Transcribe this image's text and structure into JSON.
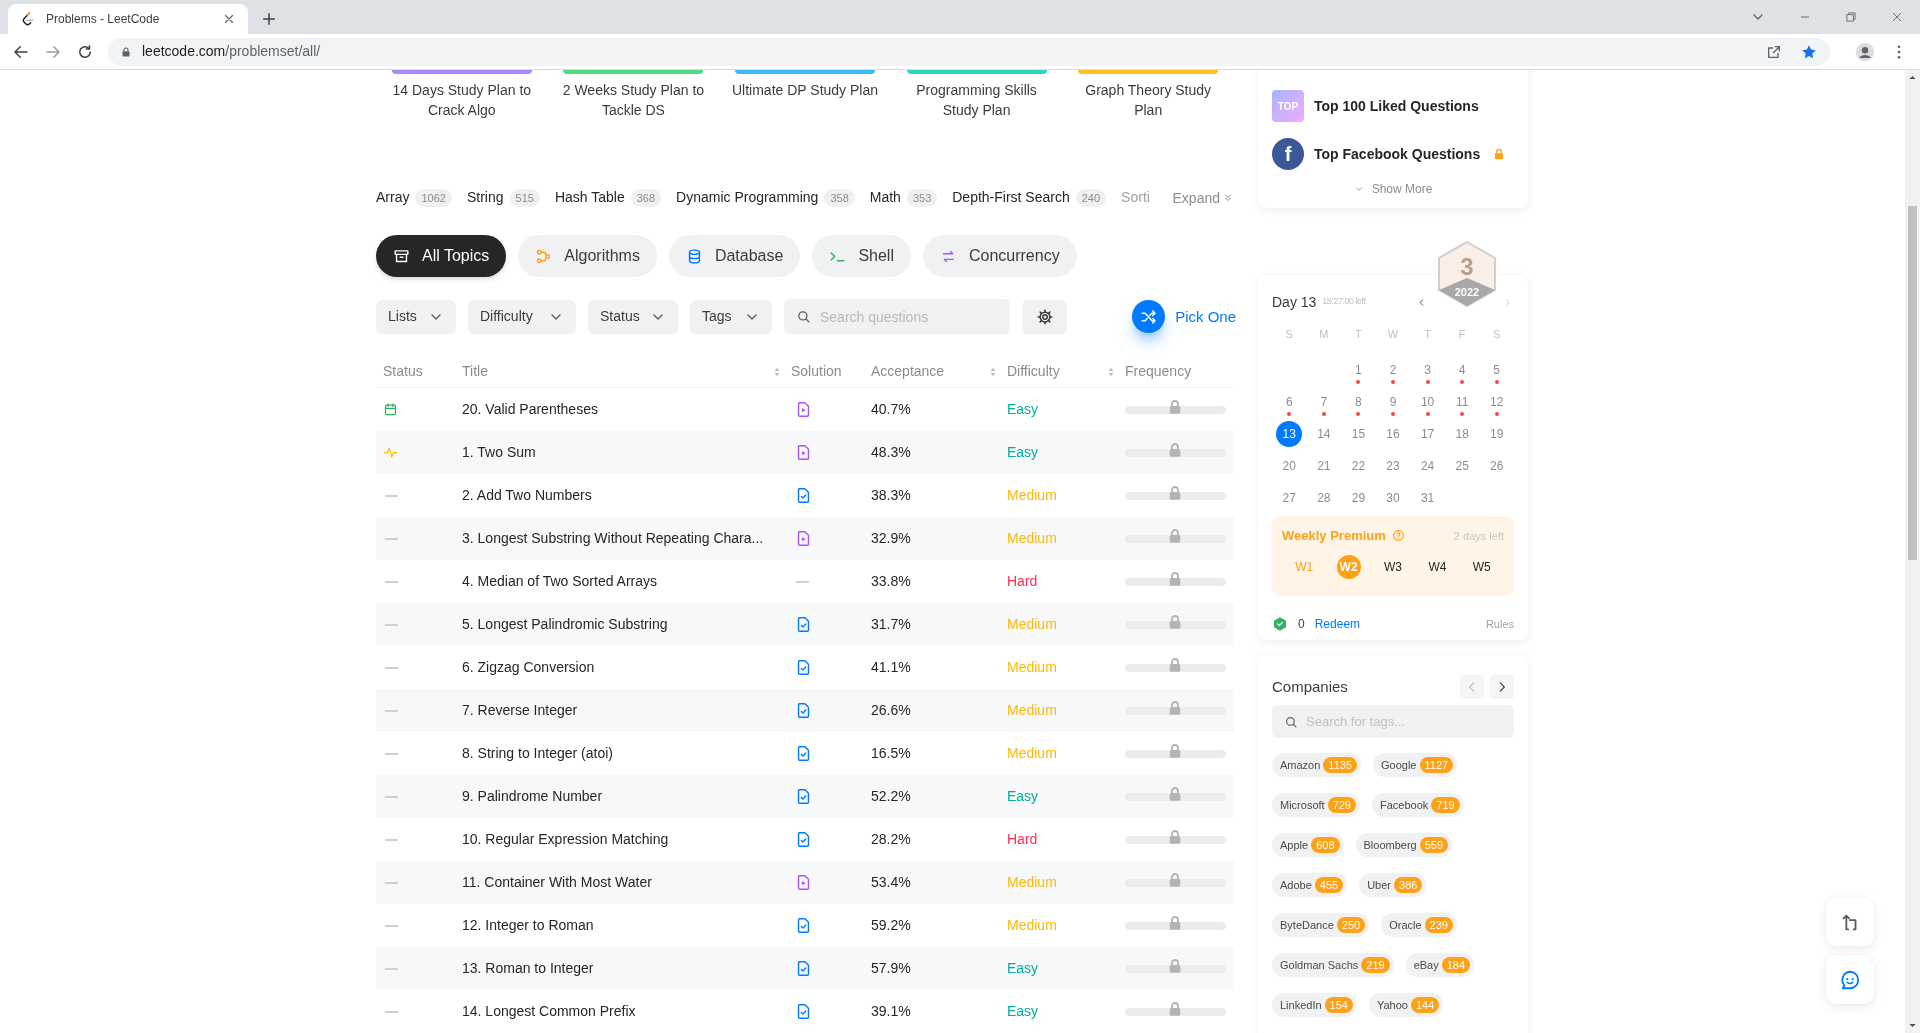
{
  "browser": {
    "tab_title": "Problems - LeetCode",
    "url_host": "leetcode.com",
    "url_path": "/problemset/all/"
  },
  "study_plans": [
    {
      "title": "14 Days Study Plan to Crack Algo",
      "color": "#a78bfa"
    },
    {
      "title": "2 Weeks Study Plan to Tackle DS",
      "color": "#4ade80"
    },
    {
      "title": "Ultimate DP Study Plan",
      "color": "#38bdf8"
    },
    {
      "title": "Programming Skills Study Plan",
      "color": "#2dd4bf"
    },
    {
      "title": "Graph Theory Study Plan",
      "color": "#fbbf24"
    }
  ],
  "tags": [
    {
      "label": "Array",
      "count": "1062"
    },
    {
      "label": "String",
      "count": "515"
    },
    {
      "label": "Hash Table",
      "count": "368"
    },
    {
      "label": "Dynamic Programming",
      "count": "358"
    },
    {
      "label": "Math",
      "count": "353"
    },
    {
      "label": "Depth-First Search",
      "count": "240"
    },
    {
      "label": "Sorti",
      "faded": true
    }
  ],
  "tags_expand": "Expand",
  "topics": [
    {
      "label": "All Topics",
      "kind": "all",
      "selected": true
    },
    {
      "label": "Algorithms",
      "kind": "algorithms",
      "selected": false
    },
    {
      "label": "Database",
      "kind": "database",
      "selected": false
    },
    {
      "label": "Shell",
      "kind": "shell",
      "selected": false
    },
    {
      "label": "Concurrency",
      "kind": "concurrency",
      "selected": false
    }
  ],
  "filters": [
    "Lists",
    "Difficulty",
    "Status",
    "Tags"
  ],
  "search": {
    "placeholder": "Search questions"
  },
  "pick_one": "Pick One",
  "table": {
    "columns": [
      {
        "label": "Status",
        "sortable": false
      },
      {
        "label": "Title",
        "sortable": true
      },
      {
        "label": "Solution",
        "sortable": false
      },
      {
        "label": "Acceptance",
        "sortable": true
      },
      {
        "label": "Difficulty",
        "sortable": true
      },
      {
        "label": "Frequency",
        "sortable": false
      }
    ],
    "rows": [
      {
        "status": {
          "kind": "daily"
        },
        "title": "20. Valid Parentheses",
        "solution": {
          "kind": "video"
        },
        "acceptance": "40.7%",
        "difficulty": {
          "text": "Easy",
          "kind": "easy"
        },
        "frequency_locked": true
      },
      {
        "status": {
          "kind": "attempted"
        },
        "title": "1. Two Sum",
        "solution": {
          "kind": "video"
        },
        "acceptance": "48.3%",
        "difficulty": {
          "text": "Easy",
          "kind": "easy"
        },
        "frequency_locked": true
      },
      {
        "status": {
          "kind": "none"
        },
        "title": "2. Add Two Numbers",
        "solution": {
          "kind": "article"
        },
        "acceptance": "38.3%",
        "difficulty": {
          "text": "Medium",
          "kind": "medium"
        },
        "frequency_locked": true
      },
      {
        "status": {
          "kind": "none"
        },
        "title": "3. Longest Substring Without Repeating Chara...",
        "solution": {
          "kind": "video"
        },
        "acceptance": "32.9%",
        "difficulty": {
          "text": "Medium",
          "kind": "medium"
        },
        "frequency_locked": true
      },
      {
        "status": {
          "kind": "none"
        },
        "title": "4. Median of Two Sorted Arrays",
        "solution": {
          "kind": "none"
        },
        "acceptance": "33.8%",
        "difficulty": {
          "text": "Hard",
          "kind": "hard"
        },
        "frequency_locked": true
      },
      {
        "status": {
          "kind": "none"
        },
        "title": "5. Longest Palindromic Substring",
        "solution": {
          "kind": "article"
        },
        "acceptance": "31.7%",
        "difficulty": {
          "text": "Medium",
          "kind": "medium"
        },
        "frequency_locked": true
      },
      {
        "status": {
          "kind": "none"
        },
        "title": "6. Zigzag Conversion",
        "solution": {
          "kind": "article"
        },
        "acceptance": "41.1%",
        "difficulty": {
          "text": "Medium",
          "kind": "medium"
        },
        "frequency_locked": true
      },
      {
        "status": {
          "kind": "none"
        },
        "title": "7. Reverse Integer",
        "solution": {
          "kind": "article"
        },
        "acceptance": "26.6%",
        "difficulty": {
          "text": "Medium",
          "kind": "medium"
        },
        "frequency_locked": true
      },
      {
        "status": {
          "kind": "none"
        },
        "title": "8. String to Integer (atoi)",
        "solution": {
          "kind": "article"
        },
        "acceptance": "16.5%",
        "difficulty": {
          "text": "Medium",
          "kind": "medium"
        },
        "frequency_locked": true
      },
      {
        "status": {
          "kind": "none"
        },
        "title": "9. Palindrome Number",
        "solution": {
          "kind": "article"
        },
        "acceptance": "52.2%",
        "difficulty": {
          "text": "Easy",
          "kind": "easy"
        },
        "frequency_locked": true
      },
      {
        "status": {
          "kind": "none"
        },
        "title": "10. Regular Expression Matching",
        "solution": {
          "kind": "article"
        },
        "acceptance": "28.2%",
        "difficulty": {
          "text": "Hard",
          "kind": "hard"
        },
        "frequency_locked": true
      },
      {
        "status": {
          "kind": "none"
        },
        "title": "11. Container With Most Water",
        "solution": {
          "kind": "video"
        },
        "acceptance": "53.4%",
        "difficulty": {
          "text": "Medium",
          "kind": "medium"
        },
        "frequency_locked": true
      },
      {
        "status": {
          "kind": "none"
        },
        "title": "12. Integer to Roman",
        "solution": {
          "kind": "article"
        },
        "acceptance": "59.2%",
        "difficulty": {
          "text": "Medium",
          "kind": "medium"
        },
        "frequency_locked": true
      },
      {
        "status": {
          "kind": "none"
        },
        "title": "13. Roman to Integer",
        "solution": {
          "kind": "article"
        },
        "acceptance": "57.9%",
        "difficulty": {
          "text": "Easy",
          "kind": "easy"
        },
        "frequency_locked": true
      },
      {
        "status": {
          "kind": "none"
        },
        "title": "14. Longest Common Prefix",
        "solution": {
          "kind": "article"
        },
        "acceptance": "39.1%",
        "difficulty": {
          "text": "Easy",
          "kind": "easy"
        },
        "frequency_locked": true
      }
    ]
  },
  "featured_lists": {
    "items": [
      {
        "title": "Top 100 Liked Questions",
        "kind": "top",
        "icon_text": "TOP",
        "locked": false
      },
      {
        "title": "Top Facebook Questions",
        "kind": "facebook",
        "icon_text": "f",
        "locked": true
      }
    ],
    "show_more": "Show More"
  },
  "calendar": {
    "title": "Day 13",
    "time_left": "18:27:00 left",
    "badge": {
      "number": "3",
      "year": "2022"
    },
    "weekdays": [
      "S",
      "M",
      "T",
      "W",
      "T",
      "F",
      "S"
    ],
    "weeks": [
      [
        {
          "label": "1",
          "marked": true,
          "selected": false
        },
        {
          "label": "2",
          "marked": true,
          "selected": false
        },
        {
          "label": "3",
          "marked": true,
          "selected": false
        },
        {
          "label": "4",
          "marked": true,
          "selected": false
        },
        {
          "label": "5",
          "marked": true,
          "selected": false
        }
      ],
      [
        {
          "label": "6",
          "marked": true,
          "selected": false
        },
        {
          "label": "7",
          "marked": true,
          "selected": false
        },
        {
          "label": "8",
          "marked": true,
          "selected": false
        },
        {
          "label": "9",
          "marked": true,
          "selected": false
        },
        {
          "label": "10",
          "marked": true,
          "selected": false
        },
        {
          "label": "11",
          "marked": true,
          "selected": false
        },
        {
          "label": "12",
          "marked": true,
          "selected": false
        }
      ],
      [
        {
          "label": "13",
          "marked": false,
          "selected": true
        },
        {
          "label": "14",
          "marked": false,
          "selected": false
        },
        {
          "label": "15",
          "marked": false,
          "selected": false
        },
        {
          "label": "16",
          "marked": false,
          "selected": false
        },
        {
          "label": "17",
          "marked": false,
          "selected": false
        },
        {
          "label": "18",
          "marked": false,
          "selected": false
        },
        {
          "label": "19",
          "marked": false,
          "selected": false
        }
      ],
      [
        {
          "label": "20",
          "marked": false,
          "selected": false
        },
        {
          "label": "21",
          "marked": false,
          "selected": false
        },
        {
          "label": "22",
          "marked": false,
          "selected": false
        },
        {
          "label": "23",
          "marked": false,
          "selected": false
        },
        {
          "label": "24",
          "marked": false,
          "selected": false
        },
        {
          "label": "25",
          "marked": false,
          "selected": false
        },
        {
          "label": "26",
          "marked": false,
          "selected": false
        }
      ],
      [
        {
          "label": "27",
          "marked": false,
          "selected": false
        },
        {
          "label": "28",
          "marked": false,
          "selected": false
        },
        {
          "label": "29",
          "marked": false,
          "selected": false
        },
        {
          "label": "30",
          "marked": false,
          "selected": false
        },
        {
          "label": "31",
          "marked": false,
          "selected": false
        }
      ]
    ],
    "weekly_premium": {
      "title": "Weekly Premium",
      "days_left": "2 days left",
      "weeks": [
        {
          "label": "W1",
          "passed": true,
          "selected": false
        },
        {
          "label": "W2",
          "passed": false,
          "selected": true
        },
        {
          "label": "W3",
          "passed": false,
          "selected": false
        },
        {
          "label": "W4",
          "passed": false,
          "selected": false
        },
        {
          "label": "W5",
          "passed": false,
          "selected": false
        }
      ]
    },
    "coins": "0",
    "redeem": "Redeem",
    "rules": "Rules"
  },
  "companies": {
    "title": "Companies",
    "search_placeholder": "Search for tags...",
    "tags": [
      {
        "name": "Amazon",
        "count": "1135"
      },
      {
        "name": "Google",
        "count": "1127"
      },
      {
        "name": "Microsoft",
        "count": "729"
      },
      {
        "name": "Facebook",
        "count": "719"
      },
      {
        "name": "Apple",
        "count": "608"
      },
      {
        "name": "Bloomberg",
        "count": "559"
      },
      {
        "name": "Adobe",
        "count": "455"
      },
      {
        "name": "Uber",
        "count": "386"
      },
      {
        "name": "ByteDance",
        "count": "250"
      },
      {
        "name": "Oracle",
        "count": "239"
      },
      {
        "name": "Goldman Sachs",
        "count": "219"
      },
      {
        "name": "eBay",
        "count": "184"
      },
      {
        "name": "LinkedIn",
        "count": "154"
      },
      {
        "name": "Yahoo",
        "count": "144"
      }
    ]
  }
}
